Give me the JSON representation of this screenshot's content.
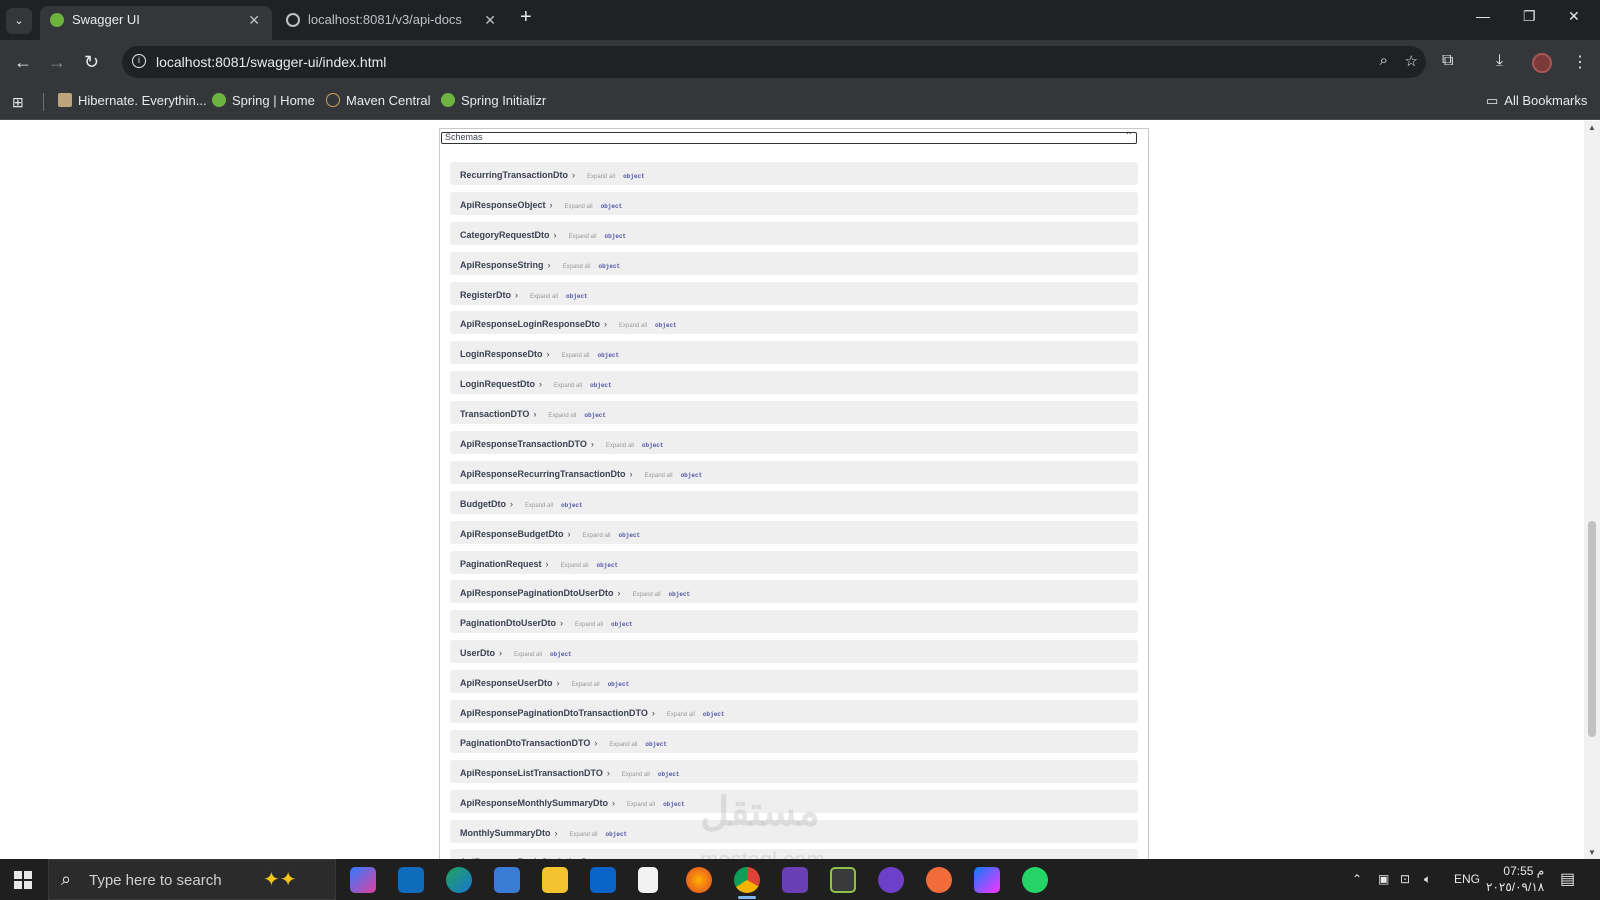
{
  "browser": {
    "tabs": [
      {
        "title": "Swagger UI",
        "active": true
      },
      {
        "title": "localhost:8081/v3/api-docs",
        "active": false
      }
    ],
    "address": "localhost:8081/swagger-ui/index.html",
    "bookmarks": [
      {
        "label": "Hibernate. Everythin..."
      },
      {
        "label": "Spring | Home"
      },
      {
        "label": "Maven Central"
      },
      {
        "label": "Spring Initializr"
      }
    ],
    "all_bookmarks": "All Bookmarks"
  },
  "schemas": {
    "title": "Schemas",
    "expand_label": "Expand all",
    "type_label": "object",
    "models": [
      "RecurringTransactionDto",
      "ApiResponseObject",
      "CategoryRequestDto",
      "ApiResponseString",
      "RegisterDto",
      "ApiResponseLoginResponseDto",
      "LoginResponseDto",
      "LoginRequestDto",
      "TransactionDTO",
      "ApiResponseTransactionDTO",
      "ApiResponseRecurringTransactionDto",
      "BudgetDto",
      "ApiResponseBudgetDto",
      "PaginationRequest",
      "ApiResponsePaginationDtoUserDto",
      "PaginationDtoUserDto",
      "UserDto",
      "ApiResponseUserDto",
      "ApiResponsePaginationDtoTransactionDTO",
      "PaginationDtoTransactionDTO",
      "ApiResponseListTransactionDTO",
      "ApiResponseMonthlySummaryDto",
      "MonthlySummaryDto",
      "ApiResponseBasicStatisticsDto"
    ]
  },
  "watermark": {
    "text": "مستقل",
    "sub": "mostaql.com"
  },
  "taskbar": {
    "search_placeholder": "Type here to search",
    "language": "ENG",
    "time": "07:55 م",
    "date": "٢٠٢٥/٠٩/١٨"
  },
  "colors": {
    "chrome_dark": "#202124",
    "chrome_toolbar": "#35363a",
    "spring_green": "#6db33f",
    "model_row_bg": "#efefef"
  }
}
